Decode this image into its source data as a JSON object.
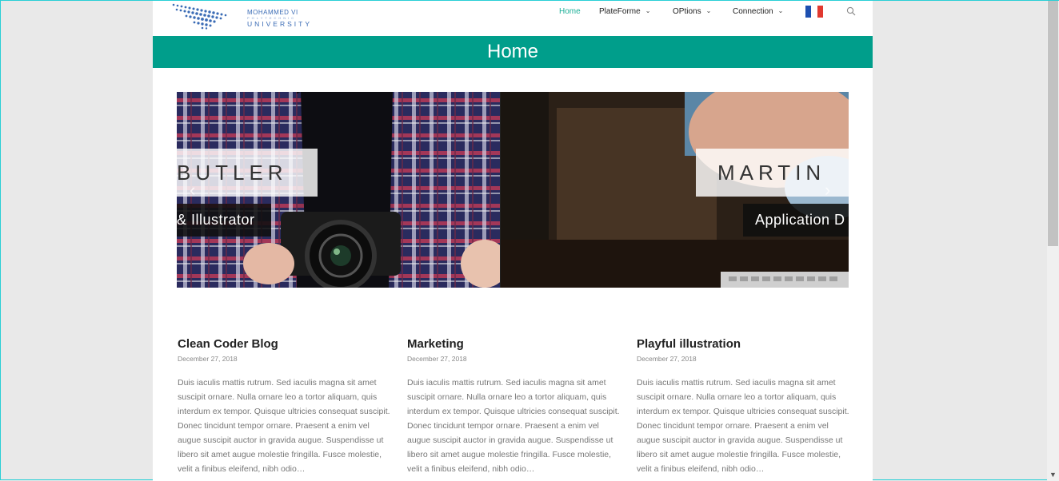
{
  "brand": {
    "line1": "MOHAMMED VI",
    "line2": "POLYTECHNIC",
    "line3": "UNIVERSITY"
  },
  "nav": {
    "items": [
      {
        "label": "Home",
        "active": true,
        "dropdown": false
      },
      {
        "label": "PlateForme",
        "active": false,
        "dropdown": true
      },
      {
        "label": "OPtions",
        "active": false,
        "dropdown": true
      },
      {
        "label": "Connection",
        "active": false,
        "dropdown": true
      }
    ],
    "caret": "⌄",
    "language_flag": "france-flag-icon",
    "search_icon": "search-icon"
  },
  "page_title": "Home",
  "slider": {
    "slides": [
      {
        "name": "BUTLER",
        "role": "& Illustrator"
      },
      {
        "name": "MARTIN",
        "role": "Application D"
      }
    ],
    "prev": "‹",
    "next": "›"
  },
  "posts": [
    {
      "title": "Clean Coder Blog",
      "date": "December 27, 2018",
      "excerpt": "Duis iaculis mattis rutrum. Sed iaculis magna sit amet suscipit ornare. Nulla ornare leo a tortor aliquam, quis interdum ex tempor. Quisque ultricies consequat suscipit. Donec tincidunt tempor ornare. Praesent a enim vel augue suscipit auctor in gravida augue. Suspendisse ut libero sit amet augue molestie fringilla. Fusce molestie, velit a finibus eleifend, nibh odio…"
    },
    {
      "title": "Marketing",
      "date": "December 27, 2018",
      "excerpt": "Duis iaculis mattis rutrum. Sed iaculis magna sit amet suscipit ornare. Nulla ornare leo a tortor aliquam, quis interdum ex tempor. Quisque ultricies consequat suscipit. Donec tincidunt tempor ornare. Praesent a enim vel augue suscipit auctor in gravida augue. Suspendisse ut libero sit amet augue molestie fringilla. Fusce molestie, velit a finibus eleifend, nibh odio…"
    },
    {
      "title": "Playful illustration",
      "date": "December 27, 2018",
      "excerpt": "Duis iaculis mattis rutrum. Sed iaculis magna sit amet suscipit ornare. Nulla ornare leo a tortor aliquam, quis interdum ex tempor. Quisque ultricies consequat suscipit. Donec tincidunt tempor ornare. Praesent a enim vel augue suscipit auctor in gravida augue. Suspendisse ut libero sit amet augue molestie fringilla. Fusce molestie, velit a finibus eleifend, nibh odio…"
    }
  ],
  "colors": {
    "accent": "#009e8b",
    "nav_active": "#1aae96",
    "brand_blue": "#3a6bb5"
  }
}
